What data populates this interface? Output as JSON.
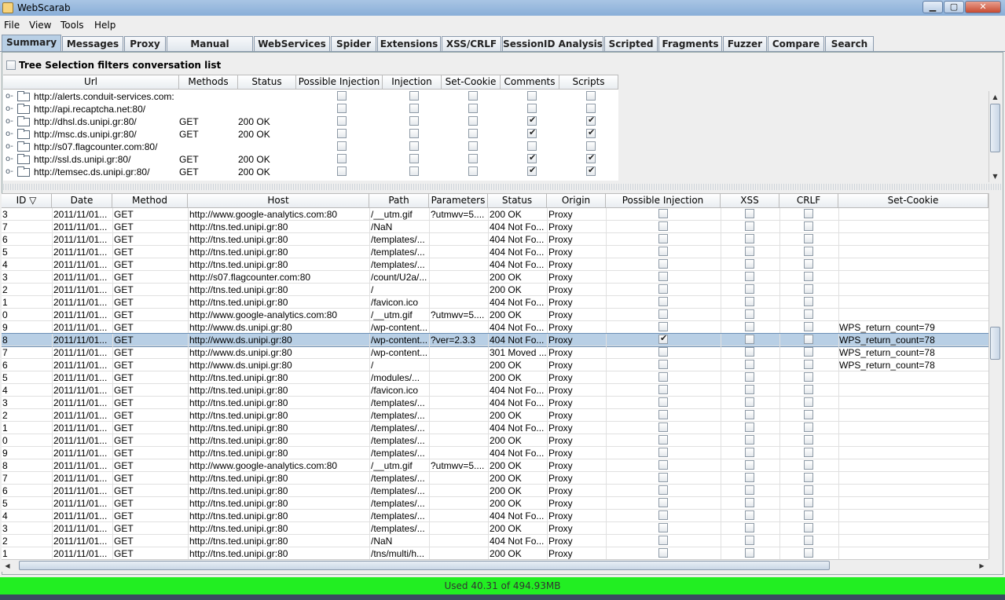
{
  "window": {
    "title": "WebScarab",
    "minimize": "▁",
    "maximize": "▢",
    "close": "✕"
  },
  "menu": [
    "File",
    "View",
    "Tools",
    "Help"
  ],
  "tabs": [
    "Summary",
    "Messages",
    "Proxy",
    "Manual Request",
    "WebServices",
    "Spider",
    "Extensions",
    "XSS/CRLF",
    "SessionID Analysis",
    "Scripted",
    "Fragments",
    "Fuzzer",
    "Compare",
    "Search"
  ],
  "tree_filter_label": "Tree Selection filters conversation list",
  "tree_table": {
    "columns": [
      "Url",
      "Methods",
      "Status",
      "Possible Injection",
      "Injection",
      "Set-Cookie",
      "Comments",
      "Scripts"
    ],
    "rows": [
      {
        "url": "http://alerts.conduit-services.com:",
        "method": "",
        "status": "",
        "comments": false,
        "scripts": false
      },
      {
        "url": "http://api.recaptcha.net:80/",
        "method": "",
        "status": "",
        "comments": false,
        "scripts": false
      },
      {
        "url": "http://dhsl.ds.unipi.gr:80/",
        "method": "GET",
        "status": "200 OK",
        "comments": true,
        "scripts": true
      },
      {
        "url": "http://msc.ds.unipi.gr:80/",
        "method": "GET",
        "status": "200 OK",
        "comments": true,
        "scripts": true
      },
      {
        "url": "http://s07.flagcounter.com:80/",
        "method": "",
        "status": "",
        "comments": false,
        "scripts": false
      },
      {
        "url": "http://ssl.ds.unipi.gr:80/",
        "method": "GET",
        "status": "200 OK",
        "comments": true,
        "scripts": true
      },
      {
        "url": "http://temsec.ds.unipi.gr:80/",
        "method": "GET",
        "status": "200 OK",
        "comments": true,
        "scripts": true
      }
    ]
  },
  "conversation_table": {
    "columns": [
      "ID ▽",
      "Date",
      "Method",
      "Host",
      "Path",
      "Parameters",
      "Status",
      "Origin",
      "Possible Injection",
      "XSS",
      "CRLF",
      "Set-Cookie"
    ],
    "rows": [
      {
        "id": "3",
        "date": "2011/11/01...",
        "method": "GET",
        "host": "http://www.google-analytics.com:80",
        "path": "/__utm.gif",
        "params": "?utmwv=5....",
        "status": "200 OK",
        "origin": "Proxy",
        "pi": false,
        "cookie": ""
      },
      {
        "id": "7",
        "date": "2011/11/01...",
        "method": "GET",
        "host": "http://tns.ted.unipi.gr:80",
        "path": "/NaN",
        "params": "",
        "status": "404 Not Fo...",
        "origin": "Proxy",
        "pi": false,
        "cookie": ""
      },
      {
        "id": "6",
        "date": "2011/11/01...",
        "method": "GET",
        "host": "http://tns.ted.unipi.gr:80",
        "path": "/templates/...",
        "params": "",
        "status": "404 Not Fo...",
        "origin": "Proxy",
        "pi": false,
        "cookie": ""
      },
      {
        "id": "5",
        "date": "2011/11/01...",
        "method": "GET",
        "host": "http://tns.ted.unipi.gr:80",
        "path": "/templates/...",
        "params": "",
        "status": "404 Not Fo...",
        "origin": "Proxy",
        "pi": false,
        "cookie": ""
      },
      {
        "id": "4",
        "date": "2011/11/01...",
        "method": "GET",
        "host": "http://tns.ted.unipi.gr:80",
        "path": "/templates/...",
        "params": "",
        "status": "404 Not Fo...",
        "origin": "Proxy",
        "pi": false,
        "cookie": ""
      },
      {
        "id": "3",
        "date": "2011/11/01...",
        "method": "GET",
        "host": "http://s07.flagcounter.com:80",
        "path": "/count/U2a/...",
        "params": "",
        "status": "200 OK",
        "origin": "Proxy",
        "pi": false,
        "cookie": ""
      },
      {
        "id": "2",
        "date": "2011/11/01...",
        "method": "GET",
        "host": "http://tns.ted.unipi.gr:80",
        "path": "/",
        "params": "",
        "status": "200 OK",
        "origin": "Proxy",
        "pi": false,
        "cookie": ""
      },
      {
        "id": "1",
        "date": "2011/11/01...",
        "method": "GET",
        "host": "http://tns.ted.unipi.gr:80",
        "path": "/favicon.ico",
        "params": "",
        "status": "404 Not Fo...",
        "origin": "Proxy",
        "pi": false,
        "cookie": ""
      },
      {
        "id": "0",
        "date": "2011/11/01...",
        "method": "GET",
        "host": "http://www.google-analytics.com:80",
        "path": "/__utm.gif",
        "params": "?utmwv=5....",
        "status": "200 OK",
        "origin": "Proxy",
        "pi": false,
        "cookie": ""
      },
      {
        "id": "9",
        "date": "2011/11/01...",
        "method": "GET",
        "host": "http://www.ds.unipi.gr:80",
        "path": "/wp-content...",
        "params": "",
        "status": "404 Not Fo...",
        "origin": "Proxy",
        "pi": false,
        "cookie": "WPS_return_count=79"
      },
      {
        "id": "8",
        "date": "2011/11/01...",
        "method": "GET",
        "host": "http://www.ds.unipi.gr:80",
        "path": "/wp-content...",
        "params": "?ver=2.3.3",
        "status": "404 Not Fo...",
        "origin": "Proxy",
        "pi": true,
        "cookie": "WPS_return_count=78",
        "selected": true
      },
      {
        "id": "7",
        "date": "2011/11/01...",
        "method": "GET",
        "host": "http://www.ds.unipi.gr:80",
        "path": "/wp-content...",
        "params": "",
        "status": "301 Moved ...",
        "origin": "Proxy",
        "pi": false,
        "cookie": "WPS_return_count=78"
      },
      {
        "id": "6",
        "date": "2011/11/01...",
        "method": "GET",
        "host": "http://www.ds.unipi.gr:80",
        "path": "/",
        "params": "",
        "status": "200 OK",
        "origin": "Proxy",
        "pi": false,
        "cookie": "WPS_return_count=78"
      },
      {
        "id": "5",
        "date": "2011/11/01...",
        "method": "GET",
        "host": "http://tns.ted.unipi.gr:80",
        "path": "/modules/...",
        "params": "",
        "status": "200 OK",
        "origin": "Proxy",
        "pi": false,
        "cookie": ""
      },
      {
        "id": "4",
        "date": "2011/11/01...",
        "method": "GET",
        "host": "http://tns.ted.unipi.gr:80",
        "path": "/favicon.ico",
        "params": "",
        "status": "404 Not Fo...",
        "origin": "Proxy",
        "pi": false,
        "cookie": ""
      },
      {
        "id": "3",
        "date": "2011/11/01...",
        "method": "GET",
        "host": "http://tns.ted.unipi.gr:80",
        "path": "/templates/...",
        "params": "",
        "status": "404 Not Fo...",
        "origin": "Proxy",
        "pi": false,
        "cookie": ""
      },
      {
        "id": "2",
        "date": "2011/11/01...",
        "method": "GET",
        "host": "http://tns.ted.unipi.gr:80",
        "path": "/templates/...",
        "params": "",
        "status": "200 OK",
        "origin": "Proxy",
        "pi": false,
        "cookie": ""
      },
      {
        "id": "1",
        "date": "2011/11/01...",
        "method": "GET",
        "host": "http://tns.ted.unipi.gr:80",
        "path": "/templates/...",
        "params": "",
        "status": "404 Not Fo...",
        "origin": "Proxy",
        "pi": false,
        "cookie": ""
      },
      {
        "id": "0",
        "date": "2011/11/01...",
        "method": "GET",
        "host": "http://tns.ted.unipi.gr:80",
        "path": "/templates/...",
        "params": "",
        "status": "200 OK",
        "origin": "Proxy",
        "pi": false,
        "cookie": ""
      },
      {
        "id": "9",
        "date": "2011/11/01...",
        "method": "GET",
        "host": "http://tns.ted.unipi.gr:80",
        "path": "/templates/...",
        "params": "",
        "status": "404 Not Fo...",
        "origin": "Proxy",
        "pi": false,
        "cookie": ""
      },
      {
        "id": "8",
        "date": "2011/11/01...",
        "method": "GET",
        "host": "http://www.google-analytics.com:80",
        "path": "/__utm.gif",
        "params": "?utmwv=5....",
        "status": "200 OK",
        "origin": "Proxy",
        "pi": false,
        "cookie": ""
      },
      {
        "id": "7",
        "date": "2011/11/01...",
        "method": "GET",
        "host": "http://tns.ted.unipi.gr:80",
        "path": "/templates/...",
        "params": "",
        "status": "200 OK",
        "origin": "Proxy",
        "pi": false,
        "cookie": ""
      },
      {
        "id": "6",
        "date": "2011/11/01...",
        "method": "GET",
        "host": "http://tns.ted.unipi.gr:80",
        "path": "/templates/...",
        "params": "",
        "status": "200 OK",
        "origin": "Proxy",
        "pi": false,
        "cookie": ""
      },
      {
        "id": "5",
        "date": "2011/11/01...",
        "method": "GET",
        "host": "http://tns.ted.unipi.gr:80",
        "path": "/templates/...",
        "params": "",
        "status": "200 OK",
        "origin": "Proxy",
        "pi": false,
        "cookie": ""
      },
      {
        "id": "4",
        "date": "2011/11/01...",
        "method": "GET",
        "host": "http://tns.ted.unipi.gr:80",
        "path": "/templates/...",
        "params": "",
        "status": "404 Not Fo...",
        "origin": "Proxy",
        "pi": false,
        "cookie": ""
      },
      {
        "id": "3",
        "date": "2011/11/01...",
        "method": "GET",
        "host": "http://tns.ted.unipi.gr:80",
        "path": "/templates/...",
        "params": "",
        "status": "200 OK",
        "origin": "Proxy",
        "pi": false,
        "cookie": ""
      },
      {
        "id": "2",
        "date": "2011/11/01...",
        "method": "GET",
        "host": "http://tns.ted.unipi.gr:80",
        "path": "/NaN",
        "params": "",
        "status": "404 Not Fo...",
        "origin": "Proxy",
        "pi": false,
        "cookie": ""
      },
      {
        "id": "1",
        "date": "2011/11/01...",
        "method": "GET",
        "host": "http://tns.ted.unipi.gr:80",
        "path": "/tns/multi/h...",
        "params": "",
        "status": "200 OK",
        "origin": "Proxy",
        "pi": false,
        "cookie": ""
      }
    ]
  },
  "status_bar": "Used 40.31 of 494.93MB",
  "colors": {
    "status_bar": "#22ee22",
    "selection": "#b8cfe5",
    "titlebar": "#a9c5e4"
  }
}
